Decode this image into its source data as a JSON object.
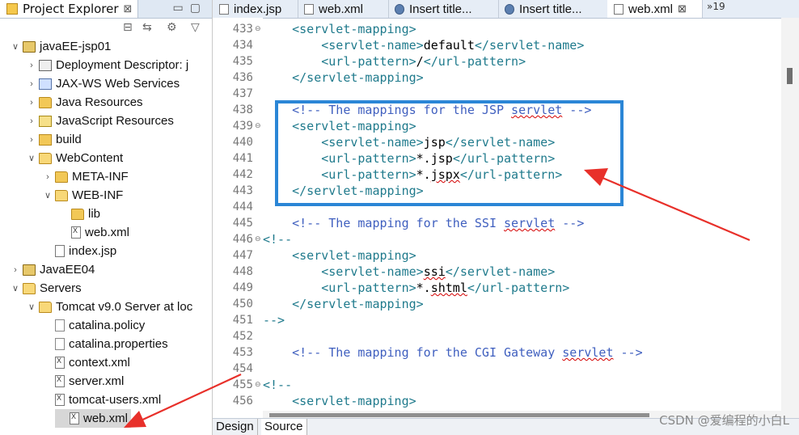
{
  "explorer": {
    "tab_label": "Project Explorer",
    "items": [
      {
        "label": "javaEE-jsp01",
        "icon": "project-icon"
      },
      {
        "label": "Deployment Descriptor: j",
        "icon": "deployment-descriptor-icon"
      },
      {
        "label": "JAX-WS Web Services",
        "icon": "web-services-icon"
      },
      {
        "label": "Java Resources",
        "icon": "java-resources-icon"
      },
      {
        "label": "JavaScript Resources",
        "icon": "javascript-resources-icon"
      },
      {
        "label": "build",
        "icon": "folder-icon"
      },
      {
        "label": "WebContent",
        "icon": "folder-open-icon"
      },
      {
        "label": "META-INF",
        "icon": "folder-icon"
      },
      {
        "label": "WEB-INF",
        "icon": "folder-open-icon"
      },
      {
        "label": "lib",
        "icon": "folder-icon"
      },
      {
        "label": "web.xml",
        "icon": "xml-file-icon"
      },
      {
        "label": "index.jsp",
        "icon": "jsp-file-icon"
      },
      {
        "label": "JavaEE04",
        "icon": "project-icon"
      },
      {
        "label": "Servers",
        "icon": "folder-open-icon"
      },
      {
        "label": "Tomcat v9.0 Server at loc",
        "icon": "folder-open-icon"
      },
      {
        "label": "catalina.policy",
        "icon": "file-icon"
      },
      {
        "label": "catalina.properties",
        "icon": "file-icon"
      },
      {
        "label": "context.xml",
        "icon": "xml-file-icon"
      },
      {
        "label": "server.xml",
        "icon": "xml-file-icon"
      },
      {
        "label": "tomcat-users.xml",
        "icon": "xml-file-icon"
      },
      {
        "label": "web.xml",
        "icon": "xml-file-icon"
      }
    ]
  },
  "editor": {
    "tabs": [
      {
        "label": "index.jsp",
        "icon": "jsp-file-icon"
      },
      {
        "label": "web.xml",
        "icon": "xml-file-icon"
      },
      {
        "label": "Insert title...",
        "icon": "browser-icon"
      },
      {
        "label": "Insert title...",
        "icon": "browser-icon"
      },
      {
        "label": "web.xml",
        "icon": "xml-file-icon"
      }
    ],
    "more_tabs": "»19",
    "lines": [
      {
        "n": "433",
        "fold": "⊖",
        "text": "    <servlet-mapping>"
      },
      {
        "n": "434",
        "fold": "",
        "text": "        <servlet-name>default</servlet-name>"
      },
      {
        "n": "435",
        "fold": "",
        "text": "        <url-pattern>/</url-pattern>"
      },
      {
        "n": "436",
        "fold": "",
        "text": "    </servlet-mapping>"
      },
      {
        "n": "437",
        "fold": "",
        "text": ""
      },
      {
        "n": "438",
        "fold": "",
        "text": "    <!-- The mappings for the JSP servlet -->"
      },
      {
        "n": "439",
        "fold": "⊖",
        "text": "    <servlet-mapping>"
      },
      {
        "n": "440",
        "fold": "",
        "text": "        <servlet-name>jsp</servlet-name>"
      },
      {
        "n": "441",
        "fold": "",
        "text": "        <url-pattern>*.jsp</url-pattern>"
      },
      {
        "n": "442",
        "fold": "",
        "text": "        <url-pattern>*.jspx</url-pattern>"
      },
      {
        "n": "443",
        "fold": "",
        "text": "    </servlet-mapping>"
      },
      {
        "n": "444",
        "fold": "",
        "text": ""
      },
      {
        "n": "445",
        "fold": "",
        "text": "    <!-- The mapping for the SSI servlet -->"
      },
      {
        "n": "446",
        "fold": "⊖",
        "text": "<!--"
      },
      {
        "n": "447",
        "fold": "",
        "text": "    <servlet-mapping>"
      },
      {
        "n": "448",
        "fold": "",
        "text": "        <servlet-name>ssi</servlet-name>"
      },
      {
        "n": "449",
        "fold": "",
        "text": "        <url-pattern>*.shtml</url-pattern>"
      },
      {
        "n": "450",
        "fold": "",
        "text": "    </servlet-mapping>"
      },
      {
        "n": "451",
        "fold": "",
        "text": "-->"
      },
      {
        "n": "452",
        "fold": "",
        "text": ""
      },
      {
        "n": "453",
        "fold": "",
        "text": "    <!-- The mapping for the CGI Gateway servlet -->"
      },
      {
        "n": "454",
        "fold": "",
        "text": ""
      },
      {
        "n": "455",
        "fold": "⊖",
        "text": "<!--"
      },
      {
        "n": "456",
        "fold": "",
        "text": "    <servlet-mapping>"
      }
    ],
    "bottom_tabs": [
      "Design",
      "Source"
    ]
  },
  "watermark": "CSDN @爱编程的小白L",
  "colors": {
    "highlight_box": "#2b86d6",
    "arrow": "#e8302a",
    "tag": "#1f7a8c",
    "comment": "#3f5fbf"
  }
}
